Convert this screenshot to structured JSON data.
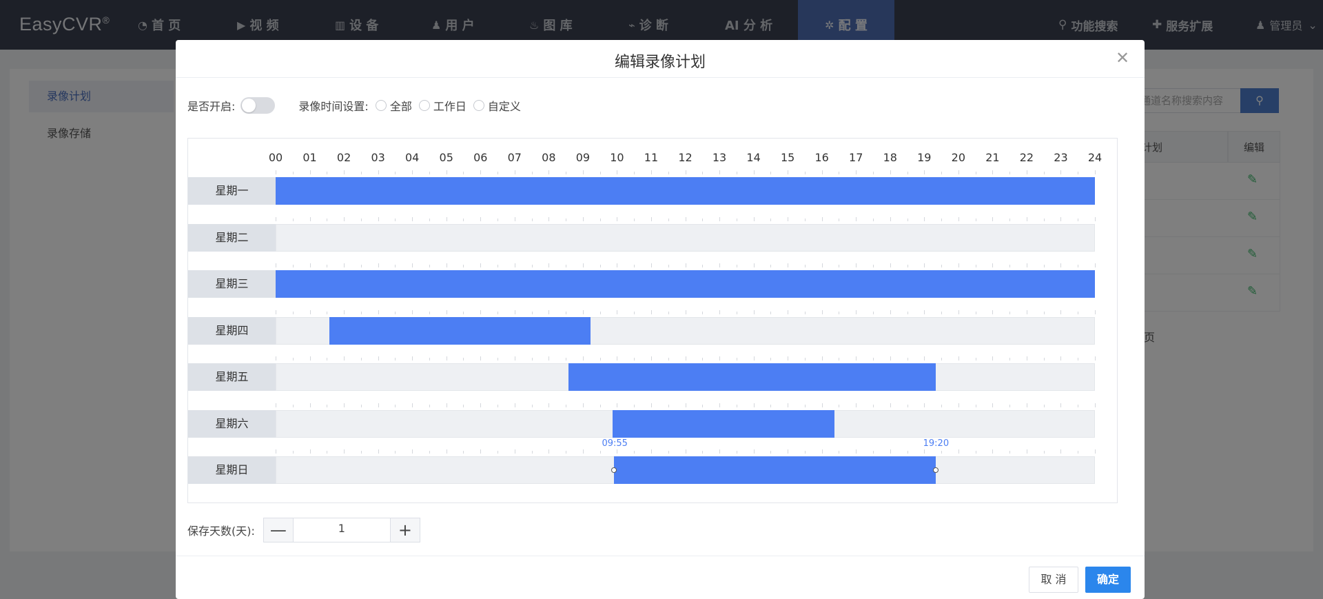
{
  "nav": {
    "brand": "EasyCVR",
    "brand_mark": "®",
    "items": [
      {
        "label": "首 页",
        "icon": "dashboard-icon",
        "glyph": "◔"
      },
      {
        "label": "视 频",
        "icon": "play-icon",
        "glyph": "▶"
      },
      {
        "label": "设 备",
        "icon": "device-icon",
        "glyph": "▥"
      },
      {
        "label": "用 户",
        "icon": "user-icon",
        "glyph": "♟"
      },
      {
        "label": "图 库",
        "icon": "alarm-icon",
        "glyph": "♨"
      },
      {
        "label": "诊 断",
        "icon": "pulse-icon",
        "glyph": "⌁"
      },
      {
        "label": "AI 分 析",
        "icon": "",
        "glyph": ""
      },
      {
        "label": "配 置",
        "icon": "gear-icon",
        "glyph": "✲"
      }
    ],
    "active_index": 7,
    "search_label": "功能搜索",
    "extensions_label": "服务扩展",
    "user_label": "管理员"
  },
  "background": {
    "sidebar": [
      "录像计划",
      "录像存储"
    ],
    "search_placeholder": "通道名称搜索内容",
    "table_headers": [
      "计划",
      "编辑"
    ],
    "pagination_tail": "页"
  },
  "modal": {
    "title": "编辑录像计划",
    "enable_label": "是否开启:",
    "time_setting_label": "录像时间设置:",
    "radio_options": [
      "全部",
      "工作日",
      "自定义"
    ],
    "hours": [
      "00",
      "01",
      "02",
      "03",
      "04",
      "05",
      "06",
      "07",
      "08",
      "09",
      "10",
      "11",
      "12",
      "13",
      "14",
      "15",
      "16",
      "17",
      "18",
      "19",
      "20",
      "21",
      "22",
      "23",
      "24"
    ],
    "days": [
      {
        "label": "星期一",
        "segments": [
          [
            0,
            24
          ]
        ]
      },
      {
        "label": "星期二",
        "segments": []
      },
      {
        "label": "星期三",
        "segments": [
          [
            0,
            24
          ]
        ]
      },
      {
        "label": "星期四",
        "segments": [
          [
            1.58,
            9.23
          ]
        ]
      },
      {
        "label": "星期五",
        "segments": [
          [
            8.58,
            19.33
          ]
        ]
      },
      {
        "label": "星期六",
        "segments": [
          [
            9.88,
            16.37
          ]
        ]
      },
      {
        "label": "星期日",
        "segments": [
          [
            9.92,
            19.33
          ]
        ],
        "tips": [
          "09:55",
          "19:20"
        ]
      }
    ],
    "retention_label": "保存天数(天):",
    "retention_value": "1",
    "minus": "—",
    "plus": "+",
    "cancel_label": "取 消",
    "ok_label": "确定",
    "colors": {
      "segment": "#4c7ef3",
      "ok_button": "#2b86ec"
    }
  }
}
